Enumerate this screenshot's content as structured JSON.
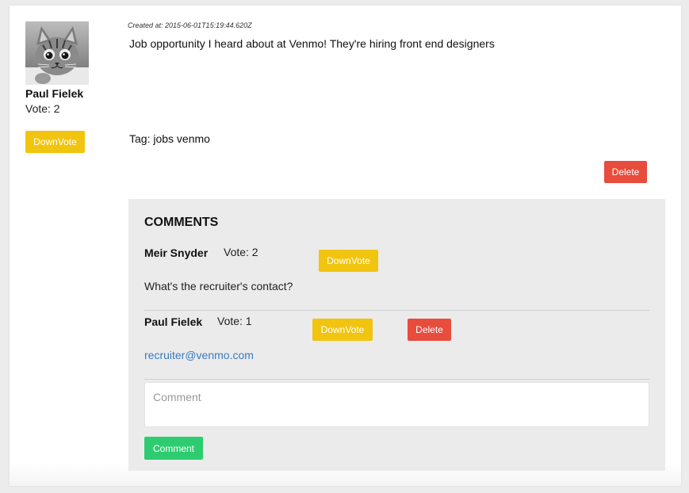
{
  "post": {
    "author": {
      "avatar_icon": "kitten-photo",
      "name": "Paul Fielek",
      "vote": "Vote: 2"
    },
    "downvote_label": "DownVote",
    "created_at": "Created at: 2015-06-01T15:19:44.620Z",
    "text": "Job opportunity I heard about at Venmo! They're hiring front end designers",
    "tag": "Tag: jobs venmo",
    "delete_label": "Delete"
  },
  "comments": {
    "title": "COMMENTS",
    "items": [
      {
        "author": "Meir Snyder",
        "vote": "Vote: 2",
        "downvote_label": "DownVote",
        "text": "What's the recruiter's contact?"
      },
      {
        "author": "Paul Fielek",
        "vote": "Vote: 1",
        "downvote_label": "DownVote",
        "delete_label": "Delete",
        "link_text": "recruiter@venmo.com"
      }
    ],
    "input_placeholder": "Comment",
    "submit_label": "Comment"
  },
  "colors": {
    "downvote": "#f1c40f",
    "delete": "#e74c3c",
    "submit": "#2ecc71",
    "link": "#3a7bbf",
    "comments_bg": "#ebebeb"
  }
}
